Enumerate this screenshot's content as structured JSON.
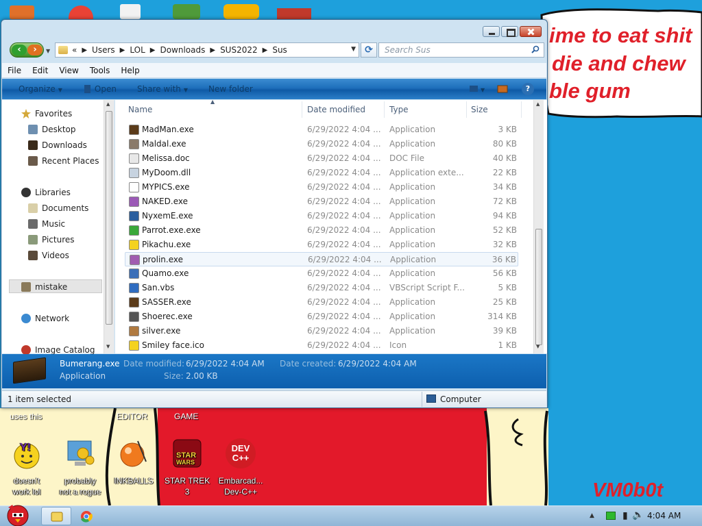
{
  "colors": {
    "desktop": "#1ea0dc",
    "scrawl": "#e0202a",
    "window_frame": "#cfe3f2",
    "command_bar": "#1e6fbb",
    "details_pane": "#1b77c6"
  },
  "desktop": {
    "scrawl_lines": [
      "ime to eat shit",
      "die and chew",
      "ble gum"
    ],
    "signature": "VM0b0t",
    "partial_labels": {
      "uses_this": "uses this",
      "editor": "EDITOR",
      "game": "GAME"
    },
    "icons": [
      {
        "name": "yahoo-messenger-icon",
        "label_lines": [
          "doesn't",
          "work lol"
        ]
      },
      {
        "name": "gear-monitor-icon",
        "label_lines": [
          "probably",
          "not a rogue"
        ]
      },
      {
        "name": "inkball-icon",
        "label_lines": [
          "INKBALLS"
        ]
      },
      {
        "name": "star-trek-icon",
        "label_lines": [
          "STAR TREK",
          "3"
        ]
      },
      {
        "name": "dev-cpp-icon",
        "label_lines": [
          "Embarcad...",
          "Dev-C++"
        ]
      }
    ],
    "dev_icon_text": "DEV C++"
  },
  "window": {
    "address": {
      "overflow": "«",
      "crumbs": [
        "Users",
        "LOL",
        "Downloads",
        "SUS2022",
        "Sus"
      ]
    },
    "search_placeholder": "Search Sus",
    "menu": [
      "File",
      "Edit",
      "View",
      "Tools",
      "Help"
    ],
    "commands": {
      "organize": "Organize",
      "open": "Open",
      "share_with": "Share with",
      "new_folder": "New folder"
    },
    "nav": {
      "favorites": "Favorites",
      "desktop": "Desktop",
      "downloads": "Downloads",
      "recent": "Recent Places",
      "libraries": "Libraries",
      "documents": "Documents",
      "music": "Music",
      "pictures": "Pictures",
      "videos": "Videos",
      "mistake": "mistake",
      "network": "Network",
      "image_catalog": "Image Catalog"
    },
    "columns": {
      "name": "Name",
      "date": "Date modified",
      "type": "Type",
      "size": "Size"
    },
    "files": [
      {
        "name": "MadMan.exe",
        "date": "6/29/2022 4:04 ...",
        "type": "Application",
        "size": "3 KB",
        "icon": "madman-icon",
        "color": "#5b3b1a"
      },
      {
        "name": "Maldal.exe",
        "date": "6/29/2022 4:04 ...",
        "type": "Application",
        "size": "80 KB",
        "icon": "maldal-icon",
        "color": "#8a7a6a"
      },
      {
        "name": "Melissa.doc",
        "date": "6/29/2022 4:04 ...",
        "type": "DOC File",
        "size": "40 KB",
        "icon": "doc-file-icon",
        "color": "#e8e8e8"
      },
      {
        "name": "MyDoom.dll",
        "date": "6/29/2022 4:04 ...",
        "type": "Application exte...",
        "size": "22 KB",
        "icon": "dll-file-icon",
        "color": "#c7d3e0"
      },
      {
        "name": "MYPICS.exe",
        "date": "6/29/2022 4:04 ...",
        "type": "Application",
        "size": "34 KB",
        "icon": "mypics-icon",
        "color": "#ffffff"
      },
      {
        "name": "NAKED.exe",
        "date": "6/29/2022 4:04 ...",
        "type": "Application",
        "size": "72 KB",
        "icon": "naked-icon",
        "color": "#9b59b6"
      },
      {
        "name": "NyxemE.exe",
        "date": "6/29/2022 4:04 ...",
        "type": "Application",
        "size": "94 KB",
        "icon": "nyxeme-icon",
        "color": "#2b5f9e"
      },
      {
        "name": "Parrot.exe.exe",
        "date": "6/29/2022 4:04 ...",
        "type": "Application",
        "size": "52 KB",
        "icon": "parrot-icon",
        "color": "#3aa83a"
      },
      {
        "name": "Pikachu.exe",
        "date": "6/29/2022 4:04 ...",
        "type": "Application",
        "size": "32 KB",
        "icon": "pikachu-icon",
        "color": "#f4d21f"
      },
      {
        "name": "prolin.exe",
        "date": "6/29/2022 4:04 ...",
        "type": "Application",
        "size": "36 KB",
        "icon": "prolin-icon",
        "color": "#a05cb0"
      },
      {
        "name": "Quamo.exe",
        "date": "6/29/2022 4:04 ...",
        "type": "Application",
        "size": "56 KB",
        "icon": "quamo-icon",
        "color": "#3c6fb8"
      },
      {
        "name": "San.vbs",
        "date": "6/29/2022 4:04 ...",
        "type": "VBScript Script F...",
        "size": "5 KB",
        "icon": "vbs-script-icon",
        "color": "#2f6cc0"
      },
      {
        "name": "SASSER.exe",
        "date": "6/29/2022 4:04 ...",
        "type": "Application",
        "size": "25 KB",
        "icon": "sasser-icon",
        "color": "#5b3b1a"
      },
      {
        "name": "Shoerec.exe",
        "date": "6/29/2022 4:04 ...",
        "type": "Application",
        "size": "314 KB",
        "icon": "shoerec-icon",
        "color": "#555555"
      },
      {
        "name": "silver.exe",
        "date": "6/29/2022 4:04 ...",
        "type": "Application",
        "size": "39 KB",
        "icon": "silver-icon",
        "color": "#b07a40"
      },
      {
        "name": "Smiley face.ico",
        "date": "6/29/2022 4:04 ...",
        "type": "Icon",
        "size": "1 KB",
        "icon": "smiley-icon",
        "color": "#f4d21f"
      }
    ],
    "details": {
      "name": "Bumerang.exe",
      "kind": "Application",
      "date_modified_label": "Date modified:",
      "date_modified": "6/29/2022 4:04 AM",
      "date_created_label": "Date created:",
      "date_created": "6/29/2022 4:04 AM",
      "size_label": "Size:",
      "size": "2.00 KB"
    },
    "status": {
      "selected": "1 item selected",
      "location": "Computer"
    }
  },
  "taskbar": {
    "time": "4:04 AM"
  }
}
